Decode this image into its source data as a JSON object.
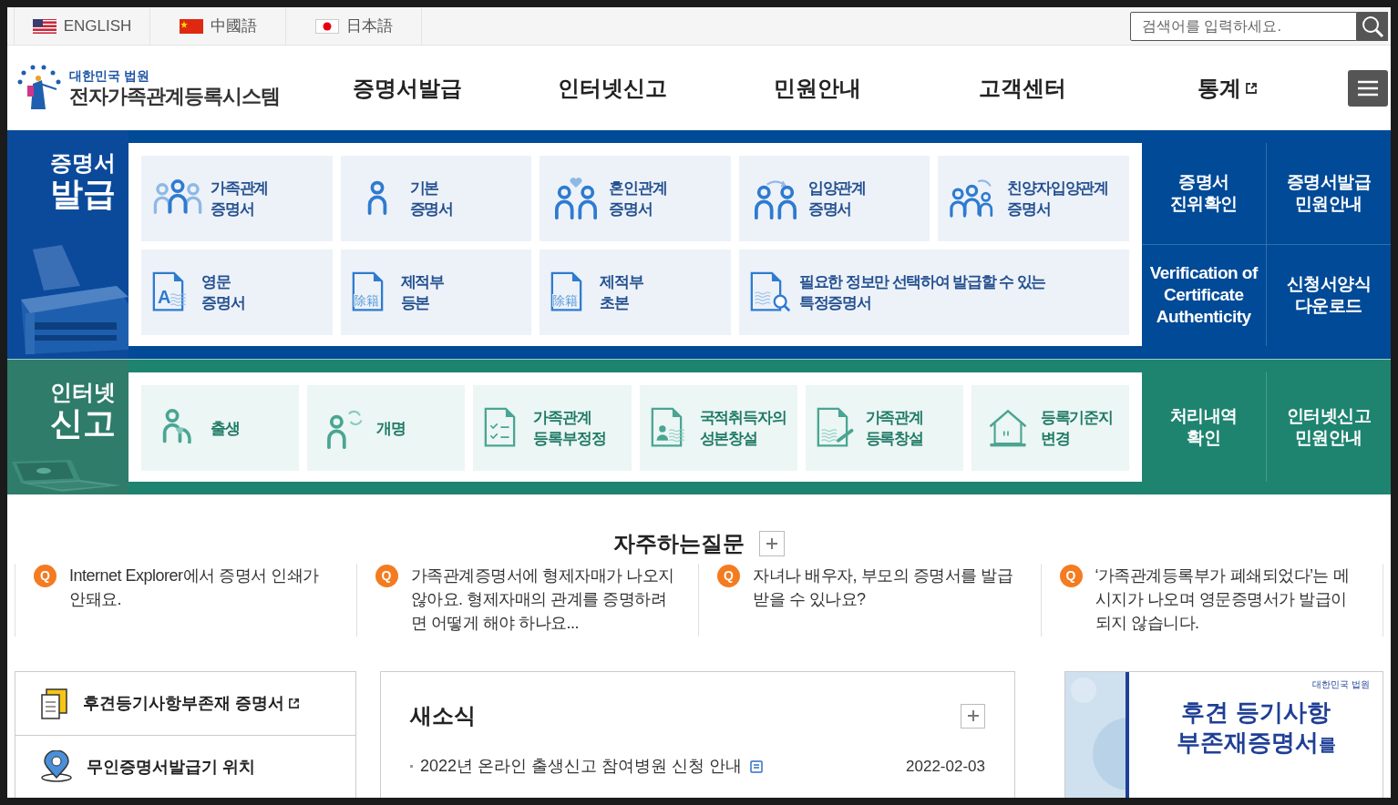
{
  "languages": [
    {
      "kind": "us",
      "label": "ENGLISH"
    },
    {
      "kind": "cn",
      "label": "中國語"
    },
    {
      "kind": "jp",
      "label": "日本語"
    }
  ],
  "search": {
    "placeholder": "검색어를 입력하세요."
  },
  "logo": {
    "subtitle": "대한민국 법원",
    "title": "전자가족관계등록시스템"
  },
  "nav": [
    {
      "label": "증명서발급",
      "external": false
    },
    {
      "label": "인터넷신고",
      "external": false
    },
    {
      "label": "민원안내",
      "external": false
    },
    {
      "label": "고객센터",
      "external": false
    },
    {
      "label": "통계",
      "external": true
    }
  ],
  "certificate_section": {
    "heading_top": "증명서",
    "heading_main": "발급",
    "tiles": [
      {
        "kind": "family",
        "lines": [
          "가족관계",
          "증명서"
        ]
      },
      {
        "kind": "basic",
        "lines": [
          "기본",
          "증명서"
        ]
      },
      {
        "kind": "marriage",
        "lines": [
          "혼인관계",
          "증명서"
        ]
      },
      {
        "kind": "adoption",
        "lines": [
          "입양관계",
          "증명서"
        ]
      },
      {
        "kind": "full-adoption",
        "lines": [
          "친양자입양관계",
          "증명서"
        ]
      },
      {
        "kind": "english",
        "icon_text": "A",
        "lines": [
          "영문",
          "증명서"
        ]
      },
      {
        "kind": "removed",
        "icon_text": "除籍",
        "lines": [
          "제적부",
          "등본"
        ]
      },
      {
        "kind": "removed",
        "icon_text": "除籍",
        "lines": [
          "제적부",
          "초본"
        ]
      },
      {
        "kind": "specific",
        "wide": true,
        "lines": [
          "필요한 정보만 선택하여 발급할 수 있는",
          "특정증명서"
        ]
      }
    ],
    "links": [
      {
        "lines": [
          "증명서",
          "진위확인"
        ]
      },
      {
        "lines": [
          "증명서발급",
          "민원안내"
        ]
      },
      {
        "lines": [
          "Verification of",
          "Certificate",
          "Authenticity"
        ]
      },
      {
        "lines": [
          "신청서양식",
          "다운로드"
        ]
      }
    ]
  },
  "report_section": {
    "heading_top": "인터넷",
    "heading_main": "신고",
    "tiles": [
      {
        "kind": "birth",
        "lines": [
          "출생"
        ]
      },
      {
        "kind": "rename",
        "lines": [
          "개명"
        ]
      },
      {
        "kind": "correction",
        "lines": [
          "가족관계",
          "등록부정정"
        ]
      },
      {
        "kind": "nationality",
        "lines": [
          "국적취득자의",
          "성본창설"
        ]
      },
      {
        "kind": "creation",
        "lines": [
          "가족관계",
          "등록창설"
        ]
      },
      {
        "kind": "domicile",
        "lines": [
          "등록기준지",
          "변경"
        ]
      }
    ],
    "links": [
      {
        "lines": [
          "처리내역",
          "확인"
        ]
      },
      {
        "lines": [
          "인터넷신고",
          "민원안내"
        ]
      }
    ]
  },
  "faq": {
    "title": "자주하는질문",
    "items": [
      {
        "marker": "Q",
        "text": "Internet Explorer에서 증명서 인쇄가 안돼요."
      },
      {
        "marker": "Q",
        "text": "가족관계증명서에 형제자매가 나오지 않아요. 형제자매의 관계를 증명하려면 어떻게 해야 하나요..."
      },
      {
        "marker": "Q",
        "text": "자녀나 배우자, 부모의 증명서를 발급 받을 수 있나요?"
      },
      {
        "marker": "Q",
        "text": "‘가족관계등록부가 폐쇄되었다’는 메시지가 나오며 영문증명서가 발급이 되지 않습니다."
      }
    ]
  },
  "shortcuts": [
    {
      "kind": "document",
      "label": "후견등기사항부존재 증명서",
      "external": true
    },
    {
      "kind": "location",
      "label": "무인증명서발급기 위치",
      "external": false
    }
  ],
  "news": {
    "title": "새소식",
    "items": [
      {
        "title": "2022년 온라인 출생신고 참여병원 신청 안내",
        "date": "2022-02-03"
      }
    ]
  },
  "banner": {
    "org": "대한민국 법원",
    "line1": "후견 등기사항",
    "line2": "부존재증명서",
    "suffix": "를"
  }
}
